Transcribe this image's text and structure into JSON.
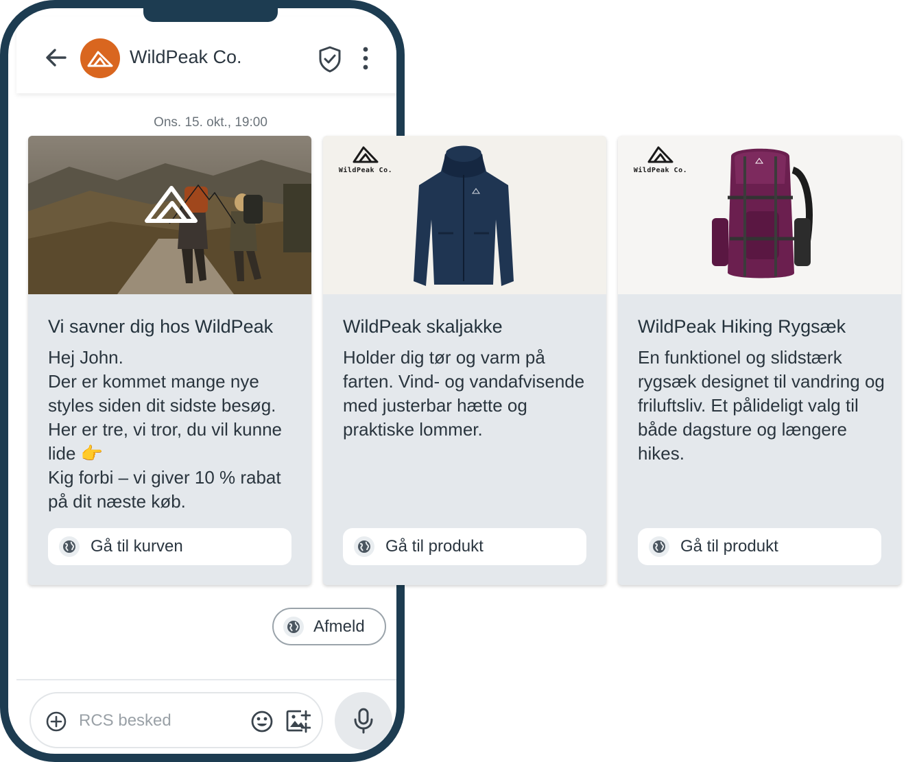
{
  "header": {
    "back_icon": "arrow-left-icon",
    "brand_name": "WildPeak Co.",
    "brand_color": "#d9661f",
    "verified_icon": "shield-check-icon",
    "more_icon": "more-vertical-icon"
  },
  "conversation": {
    "timestamp": "Ons. 15. okt., 19:00"
  },
  "carousel": {
    "cards": [
      {
        "title": "Vi savner dig hos WildPeak",
        "description": "Hej John.\nDer er kommet mange nye styles siden dit sidste besøg. Her er tre, vi tror, du vil kunne lide 👉\nKig forbi – vi giver 10 % rabat på dit næste køb.",
        "action_label": "Gå til kurven",
        "action_icon": "globe-icon"
      },
      {
        "title": "WildPeak skaljakke",
        "description": "Holder dig tør og varm på farten. Vind- og vandafvisende med justerbar hætte og praktiske lommer.",
        "action_label": "Gå til produkt",
        "action_icon": "globe-icon",
        "logo_text": "WildPeak Co."
      },
      {
        "title": "WildPeak Hiking Rygsæk",
        "description": "En funktionel og slidstærk rygsæk designet til vandring og friluftsliv. Et pålideligt valg til både dagsture og længere hikes.",
        "action_label": "Gå til produkt",
        "action_icon": "globe-icon",
        "logo_text": "WildPeak Co."
      }
    ]
  },
  "suggestion": {
    "label": "Afmeld",
    "icon": "globe-icon"
  },
  "composer": {
    "placeholder": "RCS besked",
    "add_icon": "plus-circle-icon",
    "emoji_icon": "emoji-icon",
    "image_icon": "image-add-icon",
    "mic_icon": "microphone-icon"
  },
  "colors": {
    "frame": "#1d3c51",
    "card_bg": "#e4e8ec",
    "text": "#2b3640"
  }
}
